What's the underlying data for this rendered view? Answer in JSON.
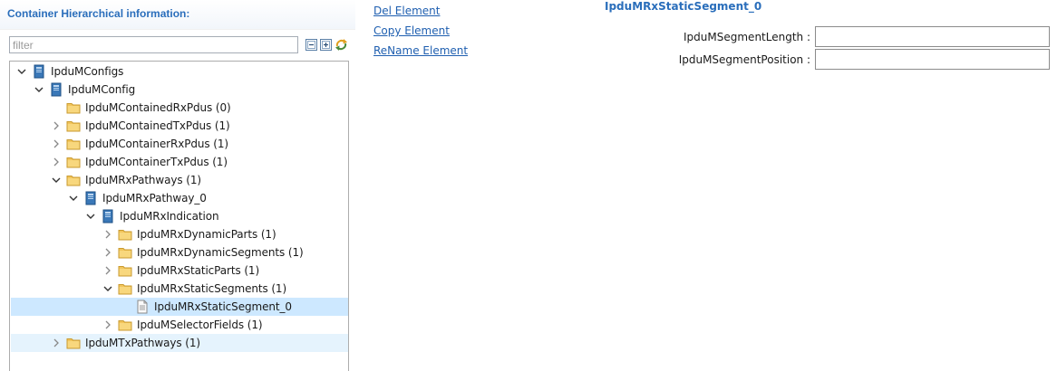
{
  "panel": {
    "title": "Container Hierarchical information:",
    "filter_placeholder": "filter",
    "filter_value": ""
  },
  "tree": {
    "nodes": [
      {
        "label": "IpduMConfigs",
        "icon": "module-icon",
        "twisty": "expanded"
      },
      {
        "label": "IpduMConfig",
        "icon": "module-icon",
        "twisty": "expanded"
      },
      {
        "label": "IpduMContainedRxPdus (0)",
        "icon": "folder-icon",
        "twisty": "none"
      },
      {
        "label": "IpduMContainedTxPdus (1)",
        "icon": "folder-icon",
        "twisty": "collapsed"
      },
      {
        "label": "IpduMContainerRxPdus (1)",
        "icon": "folder-icon",
        "twisty": "collapsed"
      },
      {
        "label": "IpduMContainerTxPdus (1)",
        "icon": "folder-icon",
        "twisty": "collapsed"
      },
      {
        "label": "IpduMRxPathways (1)",
        "icon": "folder-icon",
        "twisty": "expanded"
      },
      {
        "label": "IpduMRxPathway_0",
        "icon": "module-icon",
        "twisty": "expanded"
      },
      {
        "label": "IpduMRxIndication",
        "icon": "module-icon",
        "twisty": "expanded"
      },
      {
        "label": "IpduMRxDynamicParts (1)",
        "icon": "folder-icon",
        "twisty": "collapsed"
      },
      {
        "label": "IpduMRxDynamicSegments (1)",
        "icon": "folder-icon",
        "twisty": "collapsed"
      },
      {
        "label": "IpduMRxStaticParts (1)",
        "icon": "folder-icon",
        "twisty": "collapsed"
      },
      {
        "label": "IpduMRxStaticSegments (1)",
        "icon": "folder-icon",
        "twisty": "expanded"
      },
      {
        "label": "IpduMRxStaticSegment_0",
        "icon": "document-icon",
        "twisty": "none",
        "selected": true
      },
      {
        "label": "IpduMSelectorFields (1)",
        "icon": "folder-icon",
        "twisty": "collapsed"
      },
      {
        "label": "IpduMTxPathways (1)",
        "icon": "folder-icon",
        "twisty": "collapsed",
        "hovered": true
      }
    ]
  },
  "actions": {
    "del": "Del Element",
    "copy": "Copy Element",
    "rename": "ReName Element"
  },
  "form": {
    "title": "IpduMRxStaticSegment_0",
    "fields": [
      {
        "label": "IpduMSegmentLength :",
        "value": ""
      },
      {
        "label": "IpduMSegmentPosition :",
        "value": ""
      }
    ]
  },
  "colors": {
    "accent": "#2a6ebb",
    "link": "#1f5fb0",
    "selection": "#cde8ff",
    "hover": "#e5f3fd",
    "folder": "#f2c55c"
  }
}
